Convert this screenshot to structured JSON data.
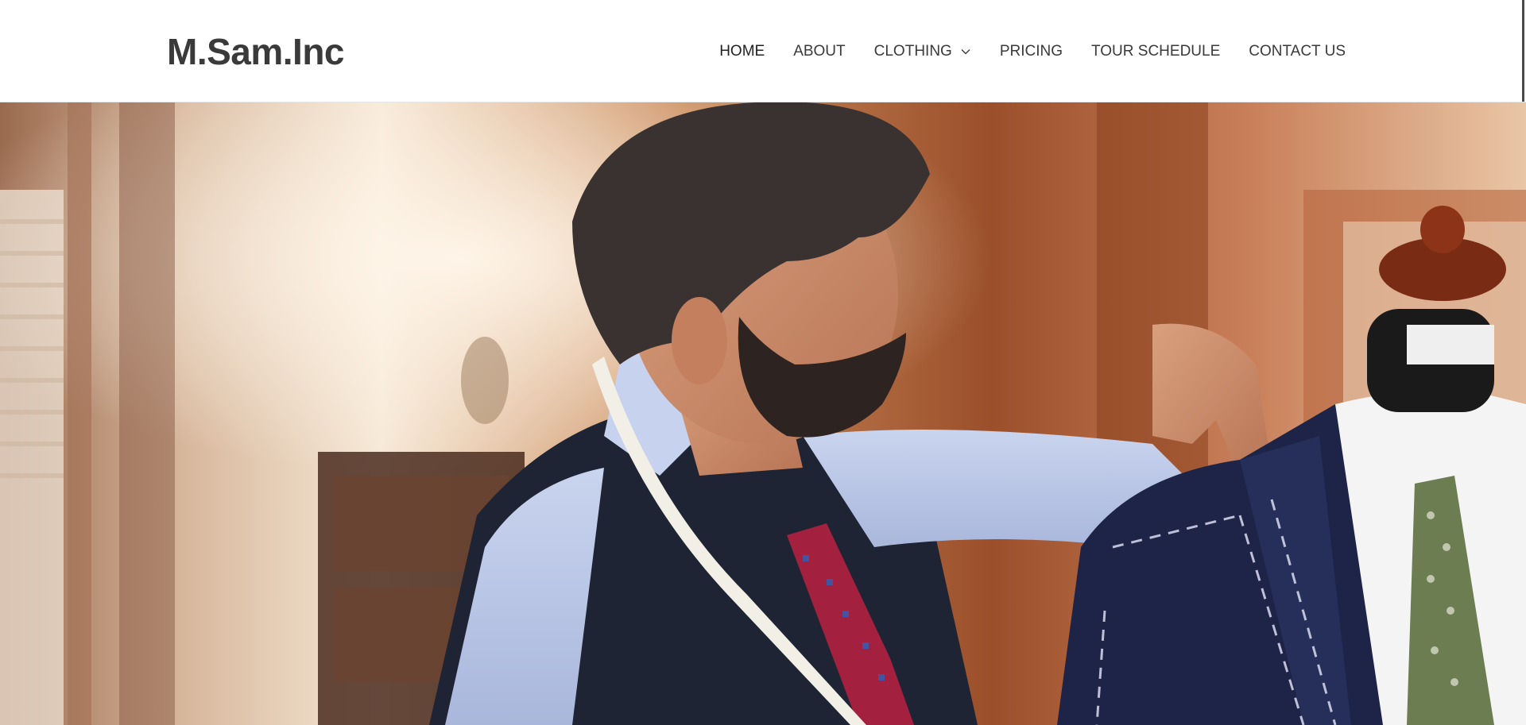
{
  "site": {
    "logo_text": "M.Sam.Inc"
  },
  "nav": {
    "items": [
      {
        "label": "HOME",
        "active": true,
        "has_dropdown": false
      },
      {
        "label": "ABOUT",
        "active": false,
        "has_dropdown": false
      },
      {
        "label": "CLOTHING",
        "active": false,
        "has_dropdown": true
      },
      {
        "label": "PRICING",
        "active": false,
        "has_dropdown": false
      },
      {
        "label": "TOUR SCHEDULE",
        "active": false,
        "has_dropdown": false
      },
      {
        "label": "CONTACT US",
        "active": false,
        "has_dropdown": false
      }
    ],
    "dropdown_icon": "chevron-down-icon"
  },
  "hero": {
    "image_subject": "tailor fitting a navy suit jacket on a mannequin"
  },
  "colors": {
    "text": "#3a3a3a",
    "header_bg": "#ffffff"
  }
}
